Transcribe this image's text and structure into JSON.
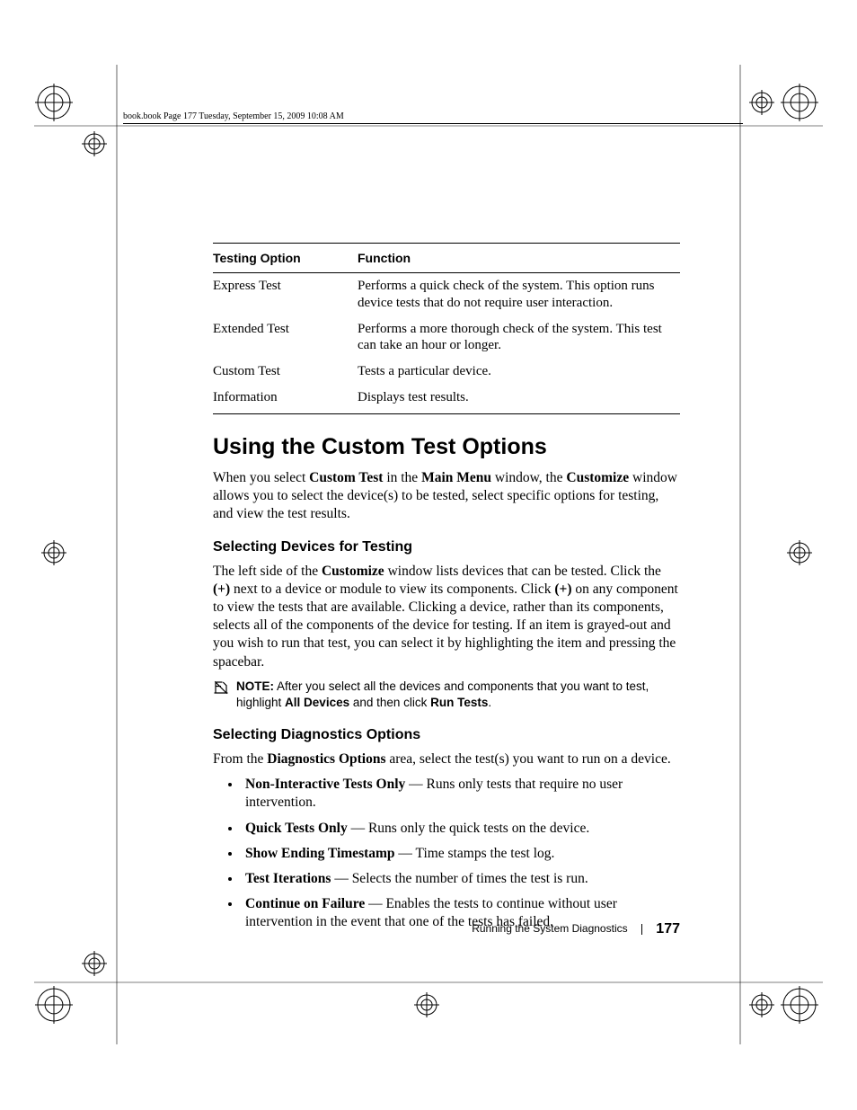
{
  "header": {
    "running_head": "book.book  Page 177  Tuesday, September 15, 2009  10:08 AM"
  },
  "table": {
    "headers": {
      "col1": "Testing Option",
      "col2": "Function"
    },
    "rows": [
      {
        "opt": "Express Test",
        "fn": "Performs a quick check of the system. This option runs device tests that do not require user interaction."
      },
      {
        "opt": "Extended Test",
        "fn": "Performs a more thorough check of the system. This test can take an hour or longer."
      },
      {
        "opt": "Custom Test",
        "fn": "Tests a particular device."
      },
      {
        "opt": "Information",
        "fn": "Displays test results."
      }
    ]
  },
  "h1": "Using the Custom Test Options",
  "intro": {
    "p1a": "When you select ",
    "p1b": "Custom Test",
    "p1c": " in the ",
    "p1d": "Main Menu",
    "p1e": " window, the ",
    "p1f": "Customize",
    "p1g": " window allows you to select the device(s) to be tested, select specific options for testing, and view the test results."
  },
  "sec1": {
    "h": "Selecting Devices for Testing",
    "p_a": "The left side of the ",
    "p_b": "Customize",
    "p_c": " window lists devices that can be tested. Click the ",
    "p_d": "(+)",
    "p_e": " next to a device or module to view its components. Click ",
    "p_f": "(+)",
    "p_g": " on any component to view the tests that are available. Clicking a device, rather than its components, selects all of the components of the device for testing. If an item is grayed-out and you wish to run that test, you can select it by highlighting the item and pressing the spacebar.",
    "note_label": "NOTE:",
    "note_1": " After you select all the devices and components that you want to test, highlight ",
    "note_2": "All Devices",
    "note_3": " and then click ",
    "note_4": "Run Tests",
    "note_5": "."
  },
  "sec2": {
    "h": "Selecting Diagnostics Options",
    "p_a": "From the ",
    "p_b": "Diagnostics Options",
    "p_c": " area, select the test(s) you want to run on a device.",
    "items": [
      {
        "b": "Non-Interactive Tests Only",
        "t": " — Runs only tests that require no user intervention."
      },
      {
        "b": "Quick Tests Only",
        "t": " — Runs only the quick tests on the device."
      },
      {
        "b": "Show Ending Timestamp",
        "t": " — Time stamps the test log."
      },
      {
        "b": "Test Iterations",
        "t": " — Selects the number of times the test is run."
      },
      {
        "b": "Continue on Failure",
        "t": " — Enables the tests to continue without user intervention in the event that one of the tests has failed."
      }
    ]
  },
  "footer": {
    "section": "Running the System Diagnostics",
    "page": "177"
  }
}
